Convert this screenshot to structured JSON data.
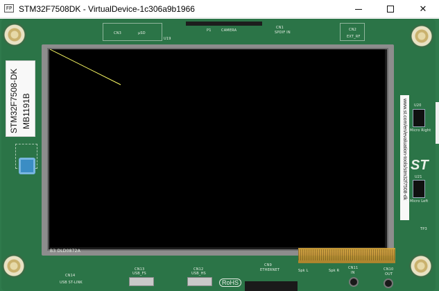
{
  "window": {
    "app_icon_text": "FP",
    "title": "STM32F7508DK - VirtualDevice-1c306a9b1966",
    "minimize_label": "",
    "maximize_label": "",
    "close_label": "✕"
  },
  "board": {
    "name": "STM32F7508-DK",
    "part_number": "MB1191B",
    "url": "www.st.com/en/evaluation-tools/stm32f7508-dk",
    "silkscreen": {
      "cn3": "CN3",
      "usd": "µSD",
      "u19": "U19",
      "p1": "P1",
      "camera": "CAMERA",
      "cn1": "CN1",
      "spdif": "SPDIF IN",
      "cn2": "CN2",
      "ext_rf": "EXT_RF",
      "u20": "U20",
      "micro_right": "Micro Right",
      "u21": "U21",
      "micro_left": "Micro Left",
      "tp3": "TP3",
      "cn14": "CN14",
      "usb_stlink": "USB ST-LINK",
      "cn13": "CN13",
      "usb_fs": "USB_FS",
      "cn12": "CN12",
      "usb_hs": "USB_HS",
      "cn9": "CN9",
      "ethernet": "ETHERNET",
      "spk_l": "Spk L",
      "spk_r": "Spk R",
      "cn11": "CN11",
      "in": "IN",
      "cn10": "CN10",
      "out": "OUT",
      "rohs": "RoHS",
      "lcd_code": "B3 DLD0872A"
    }
  },
  "lcd": {
    "background": "#000000",
    "line_color": "#ffff66"
  },
  "colors": {
    "pcb": "#2b7447",
    "button": "#3b8dc4"
  }
}
